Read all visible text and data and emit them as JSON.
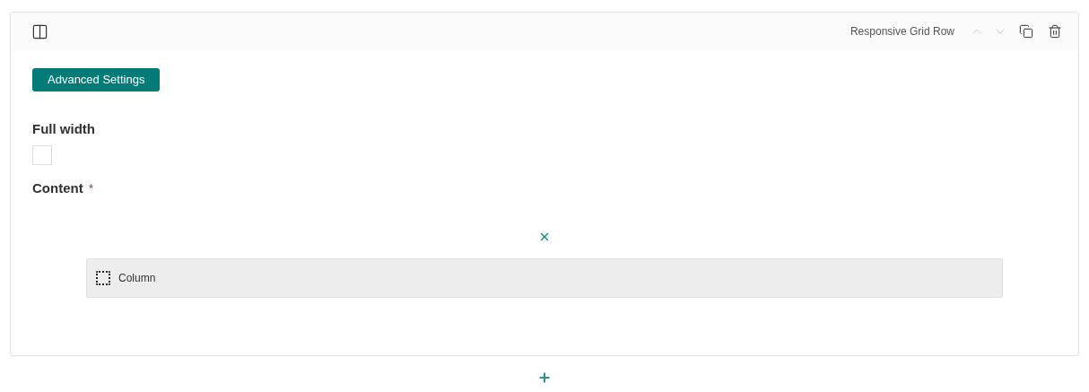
{
  "block": {
    "type_label": "Responsive Grid Row",
    "move_up": {
      "disabled": true
    },
    "move_down": {
      "disabled": true
    },
    "advanced_button": "Advanced Settings",
    "full_width": {
      "label": "Full width",
      "checked": false
    },
    "content": {
      "label": "Content",
      "required_mark": "*",
      "items": [
        {
          "label": "Column"
        }
      ]
    }
  }
}
